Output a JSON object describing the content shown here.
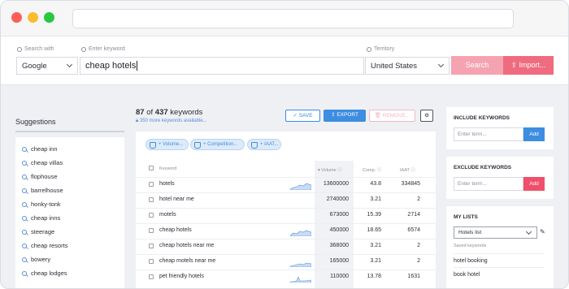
{
  "search": {
    "search_with_label": "Search with",
    "engine": "Google",
    "keyword_label": "Enter keyword",
    "keyword_value": "cheap hotels",
    "territory_label": "Territory",
    "territory": "United States",
    "search_button": "Search",
    "import_button": "Import..."
  },
  "suggestions": {
    "title": "Suggestions",
    "items": [
      "cheap inn",
      "cheap villas",
      "flophouse",
      "barrelhouse",
      "honky-tonk",
      "cheap inns",
      "steerage",
      "cheap resorts",
      "bowery",
      "cheap lodges"
    ]
  },
  "results": {
    "shown": "87",
    "of_text": "of",
    "total": "437",
    "keywords_word": "keywords",
    "more_text": "350 more keywords available...",
    "save_button": "SAVE",
    "export_button": "EXPORT",
    "remove_button": "REMOVE...",
    "filters": [
      "+ Volume...",
      "+ Competition...",
      "+ IAAT..."
    ],
    "columns": {
      "keyword": "Keyword",
      "volume": "Volume",
      "comp": "Comp.",
      "iaat": "IAAT"
    },
    "rows": [
      {
        "keyword": "hotels",
        "volume": "13600000",
        "comp": "43.8",
        "iaat": "334845"
      },
      {
        "keyword": "hotel near me",
        "volume": "2740000",
        "comp": "3.21",
        "iaat": "2"
      },
      {
        "keyword": "motels",
        "volume": "673000",
        "comp": "15.39",
        "iaat": "2714"
      },
      {
        "keyword": "cheap hotels",
        "volume": "450000",
        "comp": "18.65",
        "iaat": "6574"
      },
      {
        "keyword": "cheap hotels near me",
        "volume": "368000",
        "comp": "3.21",
        "iaat": "2"
      },
      {
        "keyword": "cheap motels near me",
        "volume": "165000",
        "comp": "3.21",
        "iaat": "2"
      },
      {
        "keyword": "pet friendly hotels",
        "volume": "110000",
        "comp": "13.78",
        "iaat": "1631"
      }
    ]
  },
  "include": {
    "title": "INCLUDE KEYWORDS",
    "placeholder": "Enter term...",
    "add": "Add"
  },
  "exclude": {
    "title": "EXCLUDE KEYWORDS",
    "placeholder": "Enter term...",
    "add": "Add"
  },
  "lists": {
    "title": "MY LISTS",
    "selected": "Hotels list",
    "saved_label": "Saved keywords",
    "saved": [
      "hotel booking",
      "book hotel"
    ]
  },
  "colors": {
    "accent_blue": "#3d8de0",
    "accent_pink": "#ef6b7f"
  }
}
